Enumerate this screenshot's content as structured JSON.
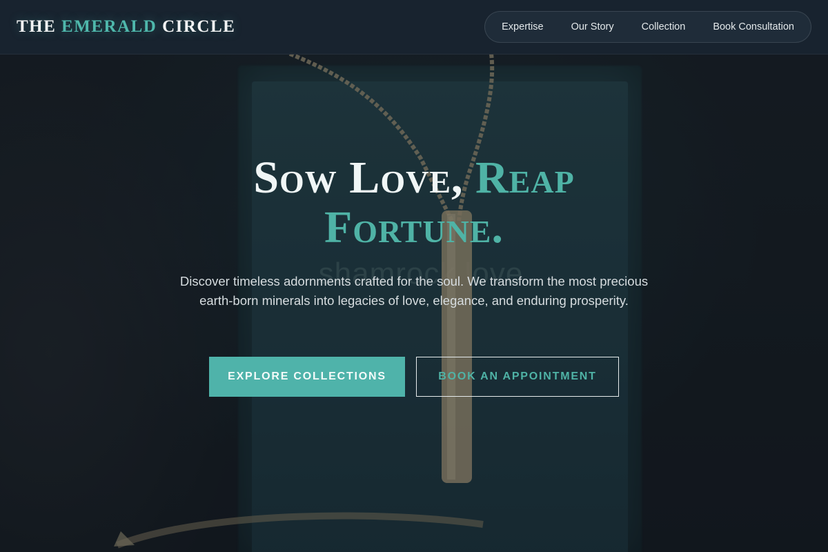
{
  "header": {
    "logo_part1": "THE ",
    "logo_accent": "EMERALD",
    "logo_part2": " CIRCLE",
    "nav": [
      {
        "label": "Expertise"
      },
      {
        "label": "Our Story"
      },
      {
        "label": "Collection"
      },
      {
        "label": "Book Consultation"
      }
    ]
  },
  "hero": {
    "headline_white": "Sow Love, ",
    "headline_teal_1": "Reap",
    "headline_teal_2": "Fortune.",
    "subtext": "Discover timeless adornments crafted for the soul. We transform the most precious earth-born minerals into legacies of love, elegance, and enduring prosperity.",
    "primary_button": "EXPLORE COLLECTIONS",
    "secondary_button": "BOOK AN APPOINTMENT",
    "background_brand_text": "shamrock love"
  },
  "colors": {
    "accent": "#4fb3a6",
    "header_bg": "#18242f",
    "page_bg": "#151b24"
  }
}
